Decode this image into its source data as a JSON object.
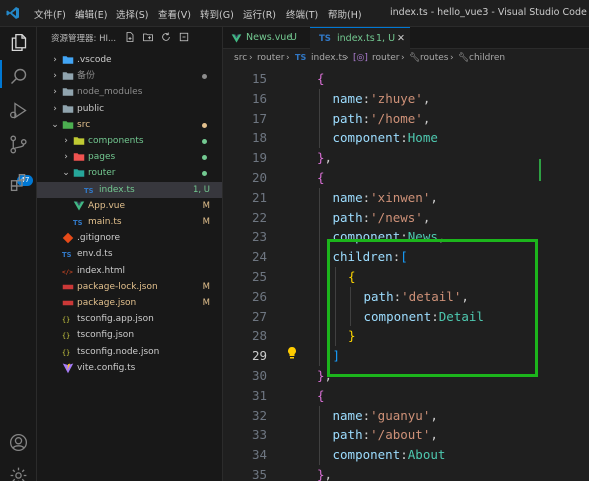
{
  "titlebar": {
    "menus": [
      "文件(F)",
      "编辑(E)",
      "选择(S)",
      "查看(V)",
      "转到(G)",
      "运行(R)",
      "终端(T)",
      "帮助(H)"
    ],
    "window_title": "index.ts - hello_vue3 - Visual Studio Code"
  },
  "activitybar": {
    "icons": [
      "files-icon",
      "search-icon",
      "run-debug-icon",
      "source-control-icon",
      "extensions-icon",
      "account-icon",
      "manage-gear-icon"
    ],
    "scm_badge": "47"
  },
  "explorer": {
    "header": "资源管理器: HI...",
    "tree": [
      {
        "label": ".vscode",
        "depth": 0,
        "type": "folder",
        "expanded": false,
        "color": "#cccccc"
      },
      {
        "label": "备份",
        "depth": 0,
        "type": "folder",
        "expanded": false,
        "color": "#8c8c8c",
        "dot": true
      },
      {
        "label": "node_modules",
        "depth": 0,
        "type": "folder",
        "expanded": false,
        "color": "#8c8c8c"
      },
      {
        "label": "public",
        "depth": 0,
        "type": "folder",
        "expanded": false,
        "color": "#cccccc"
      },
      {
        "label": "src",
        "depth": 0,
        "type": "folder",
        "expanded": true,
        "color": "#e2c08d",
        "dot": true
      },
      {
        "label": "components",
        "depth": 1,
        "type": "folder",
        "expanded": false,
        "color": "#73c991",
        "dot": true
      },
      {
        "label": "pages",
        "depth": 1,
        "type": "folder",
        "expanded": false,
        "color": "#73c991",
        "dot": true
      },
      {
        "label": "router",
        "depth": 1,
        "type": "folder",
        "expanded": true,
        "color": "#73c991",
        "dot": true
      },
      {
        "label": "index.ts",
        "depth": 2,
        "type": "ts",
        "color": "#73c991",
        "status": "1, U",
        "selected": true
      },
      {
        "label": "App.vue",
        "depth": 1,
        "type": "vue",
        "color": "#e2c08d",
        "status": "M"
      },
      {
        "label": "main.ts",
        "depth": 1,
        "type": "ts",
        "color": "#e2c08d",
        "status": "M"
      },
      {
        "label": ".gitignore",
        "depth": 0,
        "type": "git",
        "color": "#cccccc"
      },
      {
        "label": "env.d.ts",
        "depth": 0,
        "type": "ts",
        "color": "#cccccc"
      },
      {
        "label": "index.html",
        "depth": 0,
        "type": "html",
        "color": "#cccccc"
      },
      {
        "label": "package-lock.json",
        "depth": 0,
        "type": "npm",
        "color": "#e2c08d",
        "status": "M"
      },
      {
        "label": "package.json",
        "depth": 0,
        "type": "npm",
        "color": "#e2c08d",
        "status": "M"
      },
      {
        "label": "tsconfig.app.json",
        "depth": 0,
        "type": "json",
        "color": "#cccccc"
      },
      {
        "label": "tsconfig.json",
        "depth": 0,
        "type": "json",
        "color": "#cccccc"
      },
      {
        "label": "tsconfig.node.json",
        "depth": 0,
        "type": "json",
        "color": "#cccccc"
      },
      {
        "label": "vite.config.ts",
        "depth": 0,
        "type": "vite",
        "color": "#cccccc"
      }
    ]
  },
  "tabs": [
    {
      "label": "News.vue",
      "status": "U",
      "active": false
    },
    {
      "label": "index.ts",
      "status": "1, U",
      "active": true
    }
  ],
  "breadcrumb": [
    "src",
    "router",
    "index.ts",
    "router",
    "routes",
    "children"
  ],
  "editor": {
    "first_line": 15,
    "active_line": 29,
    "lines": [
      [
        [
          "b2",
          "{"
        ]
      ],
      [
        [
          "k",
          "name"
        ],
        [
          "p",
          ":"
        ],
        [
          "s",
          "'zhuye'"
        ],
        [
          "p",
          ","
        ]
      ],
      [
        [
          "k",
          "path"
        ],
        [
          "p",
          ":"
        ],
        [
          "s",
          "'/home'"
        ],
        [
          "p",
          ","
        ]
      ],
      [
        [
          "k",
          "component"
        ],
        [
          "p",
          ":"
        ],
        [
          "id",
          "Home"
        ]
      ],
      [
        [
          "b2",
          "}"
        ],
        [
          "p",
          ","
        ]
      ],
      [
        [
          "b2",
          "{"
        ]
      ],
      [
        [
          "k",
          "name"
        ],
        [
          "p",
          ":"
        ],
        [
          "s",
          "'xinwen'"
        ],
        [
          "p",
          ","
        ]
      ],
      [
        [
          "k",
          "path"
        ],
        [
          "p",
          ":"
        ],
        [
          "s",
          "'/news'"
        ],
        [
          "p",
          ","
        ]
      ],
      [
        [
          "k",
          "component"
        ],
        [
          "p",
          ":"
        ],
        [
          "id",
          "News"
        ],
        [
          "p",
          ","
        ]
      ],
      [
        [
          "k",
          "children"
        ],
        [
          "p",
          ":"
        ],
        [
          "b3",
          "["
        ]
      ],
      [
        [
          "b1",
          "{"
        ]
      ],
      [
        [
          "k",
          "path"
        ],
        [
          "p",
          ":"
        ],
        [
          "s",
          "'detail'"
        ],
        [
          "p",
          ","
        ]
      ],
      [
        [
          "k",
          "component"
        ],
        [
          "p",
          ":"
        ],
        [
          "id",
          "Detail"
        ]
      ],
      [
        [
          "b1",
          "}"
        ]
      ],
      [
        [
          "b3",
          "]"
        ]
      ],
      [
        [
          "b2",
          "}"
        ],
        [
          "p",
          ","
        ]
      ],
      [
        [
          "b2",
          "{"
        ]
      ],
      [
        [
          "k",
          "name"
        ],
        [
          "p",
          ":"
        ],
        [
          "s",
          "'guanyu'"
        ],
        [
          "p",
          ","
        ]
      ],
      [
        [
          "k",
          "path"
        ],
        [
          "p",
          ":"
        ],
        [
          "s",
          "'/about'"
        ],
        [
          "p",
          ","
        ]
      ],
      [
        [
          "k",
          "component"
        ],
        [
          "p",
          ":"
        ],
        [
          "id",
          "About"
        ]
      ],
      [
        [
          "b2",
          "}"
        ],
        [
          "p",
          ","
        ]
      ]
    ],
    "indent": [
      0,
      1,
      1,
      1,
      0,
      0,
      1,
      1,
      1,
      1,
      2,
      3,
      3,
      2,
      1,
      0,
      0,
      1,
      1,
      1,
      0
    ]
  }
}
